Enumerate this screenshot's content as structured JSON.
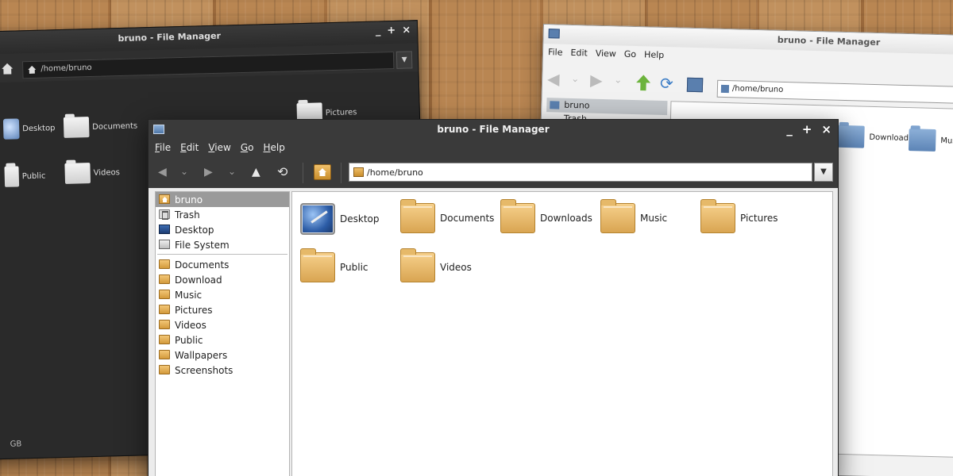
{
  "dark_window": {
    "title": "bruno - File Manager",
    "buttons": [
      "_",
      "+",
      "×"
    ],
    "location": "/home/bruno",
    "icons": [
      "Desktop",
      "Documents",
      "Pictures",
      "Public",
      "Videos"
    ],
    "status": "GB"
  },
  "light_window": {
    "title": "bruno - File Manager",
    "menu": [
      "File",
      "Edit",
      "View",
      "Go",
      "Help"
    ],
    "location": "/home/bruno",
    "sidebar_selected": "bruno",
    "sidebar_second": "Trash",
    "icons": [
      "Downloads",
      "Music"
    ]
  },
  "front_window": {
    "title": "bruno - File Manager",
    "buttons": {
      "minimize": "_",
      "maximize": "+",
      "close": "×"
    },
    "menu": [
      {
        "key": "F",
        "rest": "ile"
      },
      {
        "key": "E",
        "rest": "dit"
      },
      {
        "key": "V",
        "rest": "iew"
      },
      {
        "key": "G",
        "rest": "o"
      },
      {
        "key": "H",
        "rest": "elp"
      }
    ],
    "toolbar": {
      "back": "back-arrow-icon",
      "forward": "forward-arrow-icon",
      "up": "up-arrow-icon",
      "reload": "reload-icon",
      "home": "home-icon"
    },
    "location": "/home/bruno",
    "sidebar": {
      "places": [
        {
          "label": "bruno",
          "icon": "home",
          "selected": true
        },
        {
          "label": "Trash",
          "icon": "trash"
        },
        {
          "label": "Desktop",
          "icon": "desktop"
        },
        {
          "label": "File System",
          "icon": "fs"
        }
      ],
      "bookmarks": [
        {
          "label": "Documents"
        },
        {
          "label": "Download"
        },
        {
          "label": "Music"
        },
        {
          "label": "Pictures"
        },
        {
          "label": "Videos"
        },
        {
          "label": "Public"
        },
        {
          "label": "Wallpapers"
        },
        {
          "label": "Screenshots"
        }
      ]
    },
    "items": [
      {
        "label": "Desktop",
        "type": "desktop"
      },
      {
        "label": "Documents",
        "type": "folder"
      },
      {
        "label": "Downloads",
        "type": "folder"
      },
      {
        "label": "Music",
        "type": "folder"
      },
      {
        "label": "Pictures",
        "type": "folder"
      },
      {
        "label": "Public",
        "type": "folder"
      },
      {
        "label": "Videos",
        "type": "folder"
      }
    ]
  }
}
